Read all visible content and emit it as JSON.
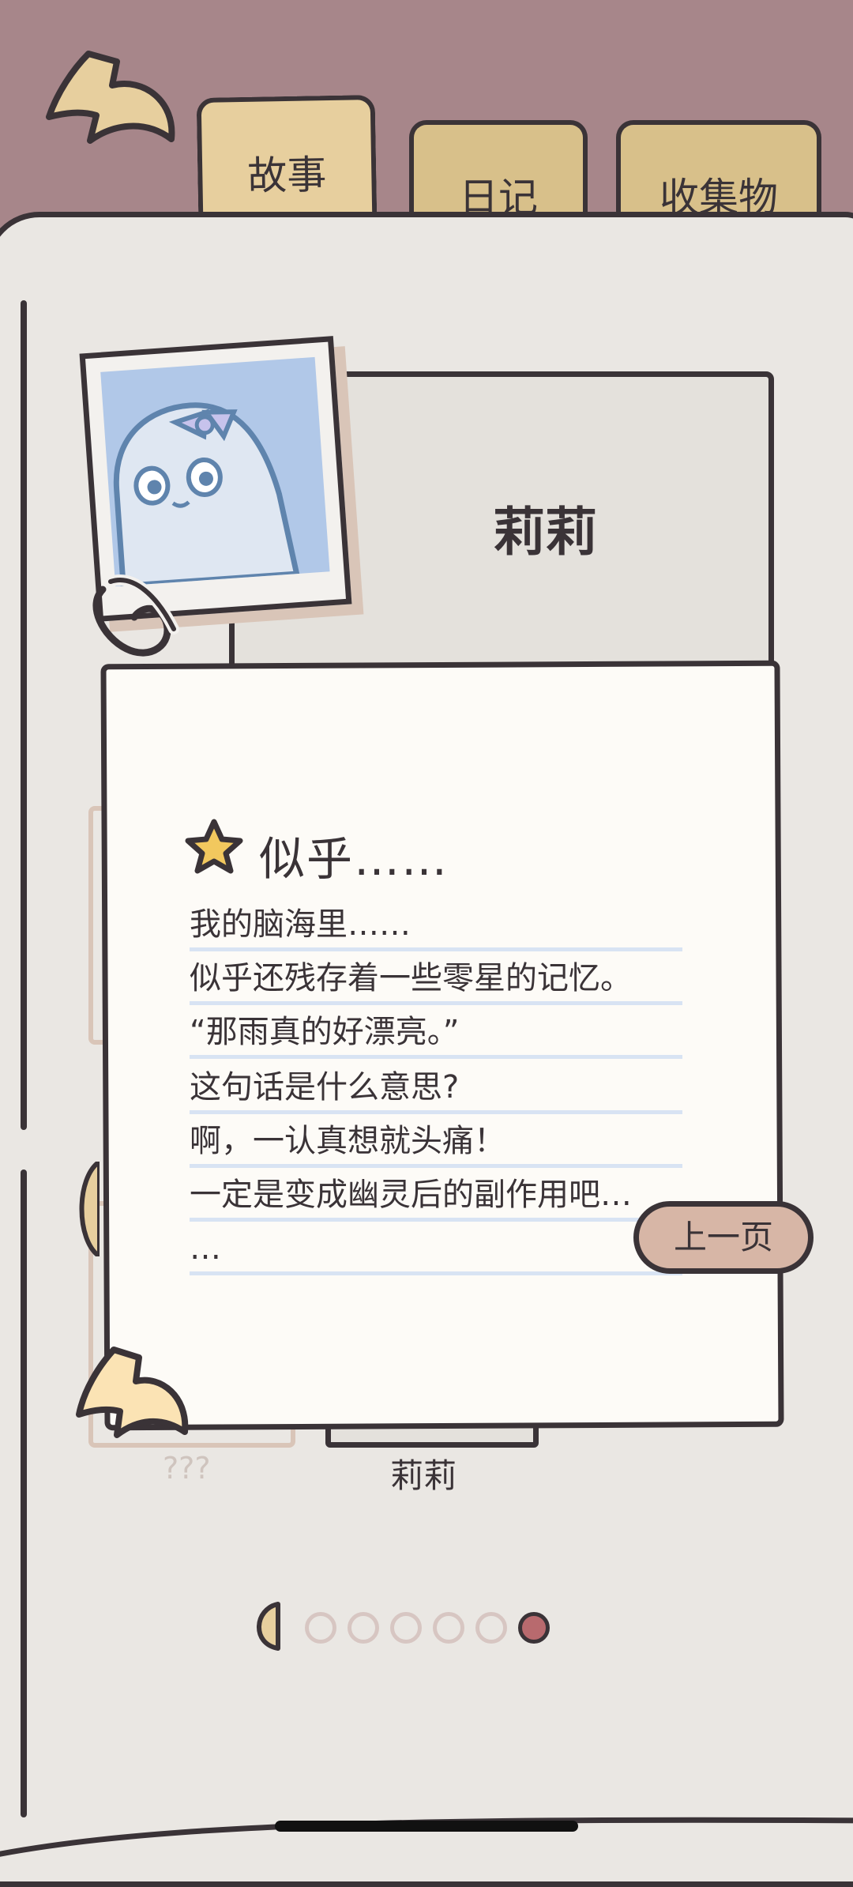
{
  "tabs": [
    {
      "label": "故事",
      "active": true
    },
    {
      "label": "日记",
      "active": false
    },
    {
      "label": "收集物",
      "active": false
    }
  ],
  "profile": {
    "name": "莉莉"
  },
  "note": {
    "title": "似乎……",
    "lines": [
      "我的脑海里……",
      "似乎还残存着一些零星的记忆。",
      "“那雨真的好漂亮。”",
      "这句话是什么意思?",
      "啊，一认真想就头痛！",
      "一定是变成幽灵后的副作用吧…",
      "…"
    ]
  },
  "buttons": {
    "prev_page": "上一页"
  },
  "labels": {
    "unknown": "???",
    "character": "莉莉"
  },
  "pager": {
    "total": 6,
    "current": 6
  },
  "colors": {
    "header_bg": "#a7868a",
    "page_bg": "#eae7e3",
    "tab_bg": "#e7cf9e",
    "photo_bg": "#b1c8e8",
    "star": "#f2c85e",
    "prev_button": "#d7b6a6",
    "active_dot": "#b86a6e"
  },
  "icons": {
    "back": "curved-back-arrow-icon",
    "star": "star-icon",
    "clip": "paperclip-icon"
  }
}
